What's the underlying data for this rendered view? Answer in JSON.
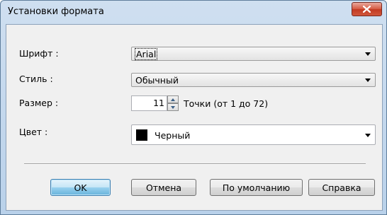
{
  "window": {
    "title": "Установки формата",
    "close_icon": "close-icon"
  },
  "font": {
    "label": "Шрифт :",
    "value": "Arial"
  },
  "style": {
    "label": "Стиль :",
    "value": "Обычный"
  },
  "size": {
    "label": "Размер :",
    "value": "11",
    "hint": "Точки (от 1 до 72)"
  },
  "color": {
    "label": "Цвет :",
    "value": "Черный",
    "swatch": "#000000"
  },
  "buttons": {
    "ok": "OK",
    "cancel": "Отмена",
    "default": "По умолчанию",
    "help": "Справка"
  }
}
